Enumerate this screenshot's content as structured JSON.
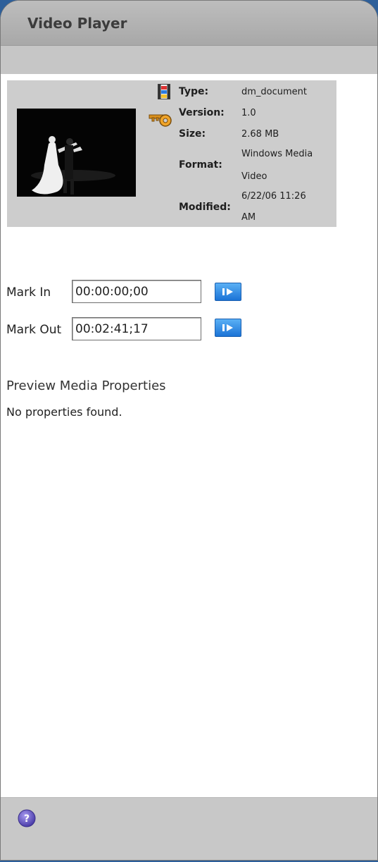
{
  "window": {
    "title": "Video Player"
  },
  "document": {
    "type_label": "Type:",
    "type_value": "dm_document",
    "version_label": "Version:",
    "version_value": "1.0",
    "size_label": "Size:",
    "size_value": "2.68 MB",
    "format_label": "Format:",
    "format_value_line1": "Windows Media",
    "format_value_line2": "Video",
    "modified_label": "Modified:",
    "modified_value_line1": "6/22/06 11:26",
    "modified_value_line2": "AM"
  },
  "mark_in": {
    "label": "Mark In",
    "value": "00:00:00;00"
  },
  "mark_out": {
    "label": "Mark Out",
    "value": "00:02:41;17"
  },
  "properties": {
    "title": "Preview Media Properties",
    "empty_text": "No properties found."
  },
  "icons": {
    "document": "document-film-icon",
    "key": "key-icon",
    "play": "play-icon",
    "help": "help-icon"
  },
  "colors": {
    "accent": "#2a86e0",
    "help": "#5a4cb3",
    "panel": "#cdcdcd"
  }
}
